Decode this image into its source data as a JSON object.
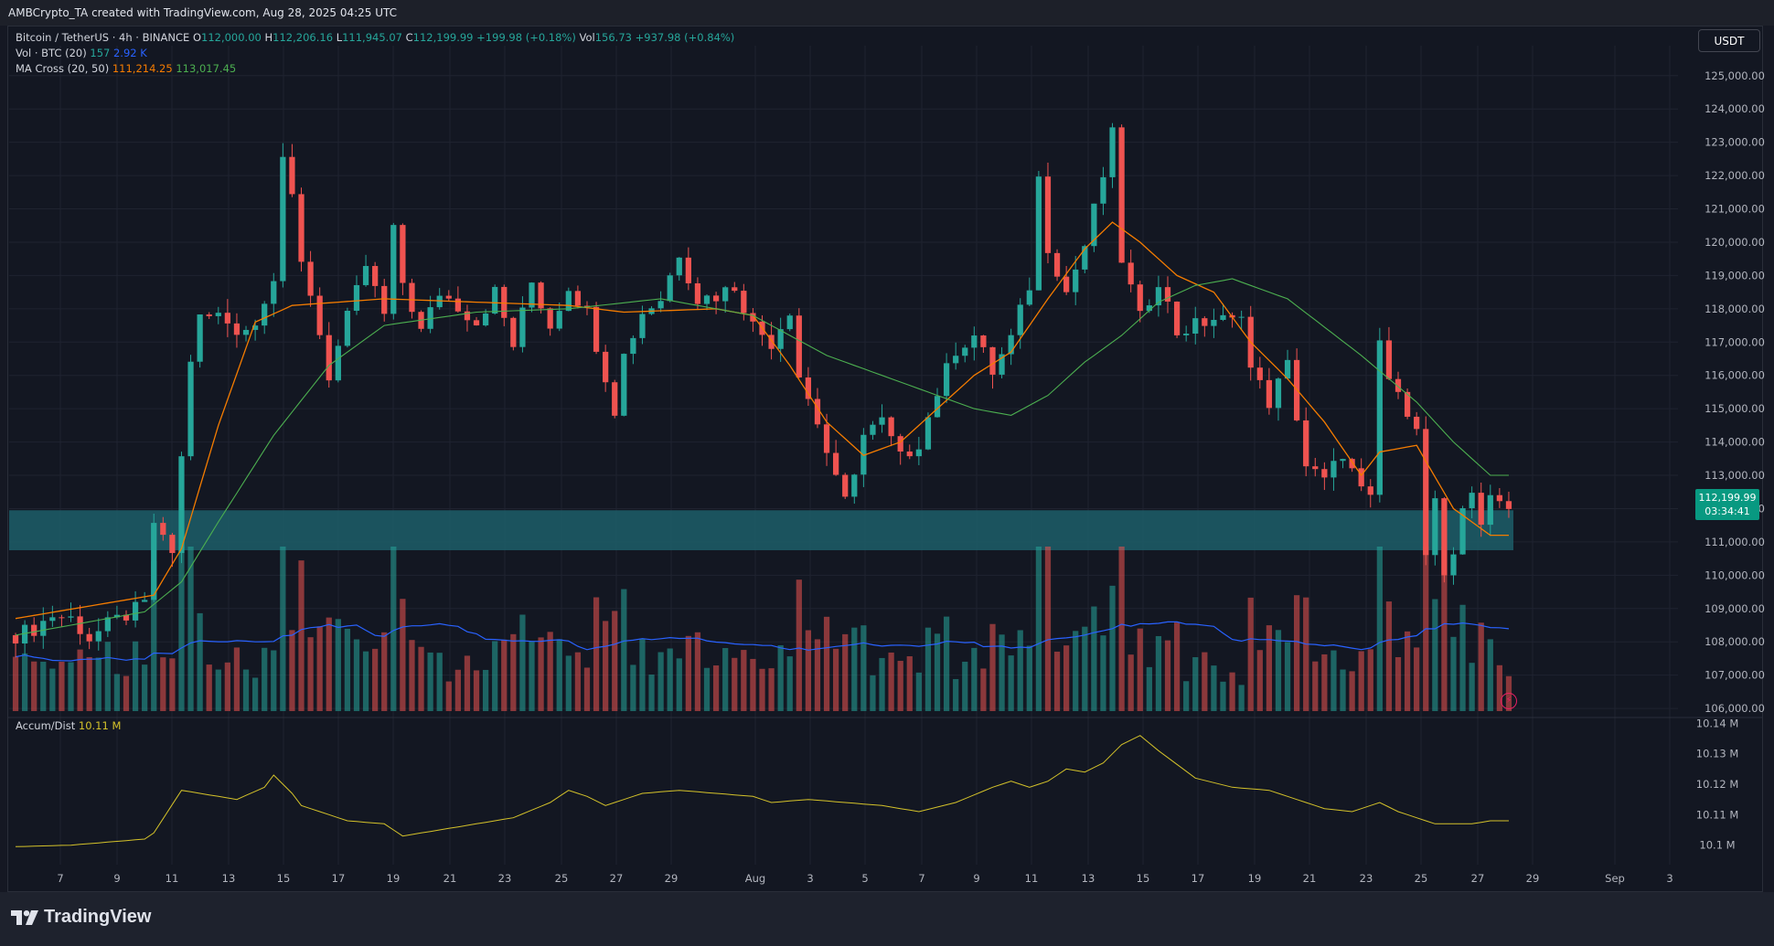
{
  "header": {
    "text": "AMBCrypto_TA created with TradingView.com, Aug 28, 2025 04:25 UTC"
  },
  "legend": {
    "symbol": "Bitcoin / TetherUS · 4h · BINANCE",
    "open_label": "O",
    "open": "112,000.00",
    "high_label": "H",
    "high": "112,206.16",
    "low_label": "L",
    "low": "111,945.07",
    "close_label": "C",
    "close": "112,199.99",
    "change": "+199.98 (+0.18%)",
    "vol_label": "Vol",
    "vol": "156.73",
    "vol_change": "+937.98 (+0.84%)",
    "vol_ind": "Vol · BTC (20)",
    "vol_ind_v1": "157",
    "vol_ind_v2": "2.92 K",
    "ma_ind": "MA Cross (20, 50)",
    "ma_v1": "111,214.25",
    "ma_v2": "113,017.45",
    "ad_ind": "Accum/Dist",
    "ad_val": "10.11 M"
  },
  "currency_button": "USDT",
  "last_price": {
    "price": "112,199.99",
    "countdown": "03:34:41"
  },
  "brand": "TradingView",
  "colors": {
    "up": "#26a69a",
    "down": "#ef5350",
    "ma_fast": "#f57c00",
    "ma_slow": "#4caf50",
    "vol_ma": "#2962ff",
    "ad_line": "#d4c22a",
    "zone": "#1d5e69"
  },
  "chart_data": [
    {
      "type": "candlestick",
      "title": "Bitcoin / TetherUS · 4h · BINANCE",
      "x_labels": [
        "7",
        "9",
        "11",
        "13",
        "15",
        "17",
        "19",
        "21",
        "23",
        "25",
        "27",
        "29",
        "Aug",
        "3",
        "5",
        "7",
        "9",
        "11",
        "13",
        "15",
        "17",
        "19",
        "21",
        "23",
        "25",
        "27",
        "29",
        "Sep",
        "3"
      ],
      "y_ticks": [
        "125,000.00",
        "124,000.00",
        "123,000.00",
        "122,000.00",
        "121,000.00",
        "120,000.00",
        "119,000.00",
        "118,000.00",
        "117,000.00",
        "116,000.00",
        "115,000.00",
        "114,000.00",
        "113,000.00",
        "112,000.00",
        "111,000.00",
        "110,000.00",
        "109,000.00",
        "108,000.00",
        "107,000.00",
        "106,000.00"
      ],
      "ylim": [
        105700,
        125900
      ],
      "support_zone": [
        110750,
        111950
      ],
      "price_path": [
        [
          0,
          108200
        ],
        [
          2,
          108400
        ],
        [
          4,
          108800
        ],
        [
          6,
          108700
        ],
        [
          8,
          108100
        ],
        [
          10,
          108500
        ],
        [
          12,
          108800
        ],
        [
          14,
          109100
        ],
        [
          15,
          111600
        ],
        [
          16,
          111000
        ],
        [
          17,
          110700
        ],
        [
          18,
          113500
        ],
        [
          19,
          116500
        ],
        [
          20,
          117700
        ],
        [
          22,
          117800
        ],
        [
          24,
          117400
        ],
        [
          26,
          117500
        ],
        [
          27,
          118400
        ],
        [
          28,
          119000
        ],
        [
          29,
          122600
        ],
        [
          30,
          121200
        ],
        [
          31,
          119300
        ],
        [
          32,
          118500
        ],
        [
          34,
          116000
        ],
        [
          36,
          117700
        ],
        [
          38,
          119300
        ],
        [
          40,
          117800
        ],
        [
          41,
          120300
        ],
        [
          42,
          118800
        ],
        [
          44,
          117300
        ],
        [
          46,
          118500
        ],
        [
          48,
          118100
        ],
        [
          50,
          117600
        ],
        [
          52,
          118500
        ],
        [
          54,
          116900
        ],
        [
          56,
          118800
        ],
        [
          58,
          117500
        ],
        [
          60,
          118700
        ],
        [
          62,
          117900
        ],
        [
          64,
          116000
        ],
        [
          65,
          115000
        ],
        [
          66,
          116600
        ],
        [
          68,
          117900
        ],
        [
          70,
          118300
        ],
        [
          72,
          119700
        ],
        [
          74,
          118300
        ],
        [
          76,
          118400
        ],
        [
          78,
          118700
        ],
        [
          80,
          117500
        ],
        [
          82,
          117000
        ],
        [
          84,
          118000
        ],
        [
          85,
          116000
        ],
        [
          87,
          114600
        ],
        [
          89,
          112800
        ],
        [
          90,
          112200
        ],
        [
          92,
          114200
        ],
        [
          94,
          114600
        ],
        [
          96,
          113500
        ],
        [
          98,
          114000
        ],
        [
          100,
          115500
        ],
        [
          102,
          116800
        ],
        [
          104,
          117200
        ],
        [
          106,
          116100
        ],
        [
          108,
          117100
        ],
        [
          110,
          118700
        ],
        [
          111,
          121900
        ],
        [
          112,
          119900
        ],
        [
          114,
          118500
        ],
        [
          116,
          119900
        ],
        [
          118,
          122000
        ],
        [
          119,
          123200
        ],
        [
          120,
          119500
        ],
        [
          121,
          118600
        ],
        [
          122,
          117700
        ],
        [
          124,
          118900
        ],
        [
          126,
          117300
        ],
        [
          128,
          117500
        ],
        [
          130,
          117700
        ],
        [
          132,
          117600
        ],
        [
          133,
          118000
        ],
        [
          134,
          116200
        ],
        [
          136,
          115200
        ],
        [
          138,
          116300
        ],
        [
          140,
          113300
        ],
        [
          142,
          112800
        ],
        [
          144,
          113700
        ],
        [
          146,
          112500
        ],
        [
          147,
          112200
        ],
        [
          148,
          117000
        ],
        [
          149,
          115900
        ],
        [
          150,
          115300
        ],
        [
          151,
          115000
        ],
        [
          152,
          114600
        ],
        [
          153,
          110500
        ],
        [
          154,
          112300
        ],
        [
          155,
          109800
        ],
        [
          156,
          110400
        ],
        [
          157,
          112000
        ],
        [
          158,
          112600
        ],
        [
          159,
          111600
        ],
        [
          160,
          112200
        ]
      ],
      "ma_20": [
        [
          0,
          108700
        ],
        [
          15,
          109400
        ],
        [
          18,
          110800
        ],
        [
          22,
          114500
        ],
        [
          26,
          117600
        ],
        [
          30,
          118100
        ],
        [
          40,
          118300
        ],
        [
          60,
          118100
        ],
        [
          66,
          117900
        ],
        [
          76,
          118000
        ],
        [
          80,
          117800
        ],
        [
          84,
          116300
        ],
        [
          88,
          114600
        ],
        [
          92,
          113600
        ],
        [
          96,
          114000
        ],
        [
          100,
          115000
        ],
        [
          104,
          116000
        ],
        [
          108,
          116700
        ],
        [
          112,
          118300
        ],
        [
          116,
          119800
        ],
        [
          119,
          120600
        ],
        [
          122,
          120000
        ],
        [
          126,
          119000
        ],
        [
          130,
          118500
        ],
        [
          134,
          117000
        ],
        [
          138,
          115900
        ],
        [
          142,
          114600
        ],
        [
          146,
          113000
        ],
        [
          148,
          113700
        ],
        [
          152,
          113900
        ],
        [
          156,
          112000
        ],
        [
          160,
          111200
        ]
      ],
      "ma_50": [
        [
          0,
          108200
        ],
        [
          14,
          108900
        ],
        [
          18,
          109800
        ],
        [
          22,
          111600
        ],
        [
          28,
          114200
        ],
        [
          34,
          116300
        ],
        [
          40,
          117500
        ],
        [
          50,
          117900
        ],
        [
          60,
          118000
        ],
        [
          70,
          118300
        ],
        [
          80,
          117800
        ],
        [
          88,
          116600
        ],
        [
          96,
          115800
        ],
        [
          104,
          115000
        ],
        [
          108,
          114800
        ],
        [
          112,
          115400
        ],
        [
          116,
          116400
        ],
        [
          120,
          117200
        ],
        [
          124,
          118200
        ],
        [
          128,
          118700
        ],
        [
          132,
          118900
        ],
        [
          138,
          118300
        ],
        [
          146,
          116600
        ],
        [
          152,
          115200
        ],
        [
          156,
          114000
        ],
        [
          160,
          113000
        ]
      ],
      "volume_scale_max": 5000
    },
    {
      "type": "line",
      "title": "Accum/Dist",
      "y_ticks": [
        "10.14 M",
        "10.13 M",
        "10.12 M",
        "10.11 M",
        "10.1 M"
      ],
      "ylim": [
        10.096,
        10.141
      ],
      "series": [
        {
          "values": [
            [
              0,
              10.0995
            ],
            [
              6,
              10.1
            ],
            [
              10,
              10.101
            ],
            [
              14,
              10.102
            ],
            [
              15,
              10.104
            ],
            [
              18,
              10.118
            ],
            [
              22,
              10.116
            ],
            [
              24,
              10.115
            ],
            [
              27,
              10.119
            ],
            [
              28,
              10.123
            ],
            [
              30,
              10.117
            ],
            [
              31,
              10.113
            ],
            [
              36,
              10.108
            ],
            [
              40,
              10.107
            ],
            [
              42,
              10.103
            ],
            [
              46,
              10.105
            ],
            [
              50,
              10.107
            ],
            [
              54,
              10.109
            ],
            [
              58,
              10.114
            ],
            [
              60,
              10.118
            ],
            [
              62,
              10.116
            ],
            [
              64,
              10.113
            ],
            [
              68,
              10.117
            ],
            [
              72,
              10.118
            ],
            [
              76,
              10.117
            ],
            [
              80,
              10.116
            ],
            [
              82,
              10.114
            ],
            [
              86,
              10.115
            ],
            [
              90,
              10.114
            ],
            [
              94,
              10.113
            ],
            [
              98,
              10.111
            ],
            [
              102,
              10.114
            ],
            [
              106,
              10.119
            ],
            [
              108,
              10.121
            ],
            [
              110,
              10.119
            ],
            [
              112,
              10.121
            ],
            [
              114,
              10.125
            ],
            [
              116,
              10.124
            ],
            [
              118,
              10.127
            ],
            [
              120,
              10.133
            ],
            [
              122,
              10.136
            ],
            [
              124,
              10.131
            ],
            [
              128,
              10.122
            ],
            [
              132,
              10.119
            ],
            [
              136,
              10.118
            ],
            [
              140,
              10.114
            ],
            [
              142,
              10.112
            ],
            [
              145,
              10.111
            ],
            [
              148,
              10.114
            ],
            [
              150,
              10.111
            ],
            [
              154,
              10.107
            ],
            [
              158,
              10.107
            ],
            [
              160,
              10.108
            ]
          ]
        }
      ]
    }
  ]
}
